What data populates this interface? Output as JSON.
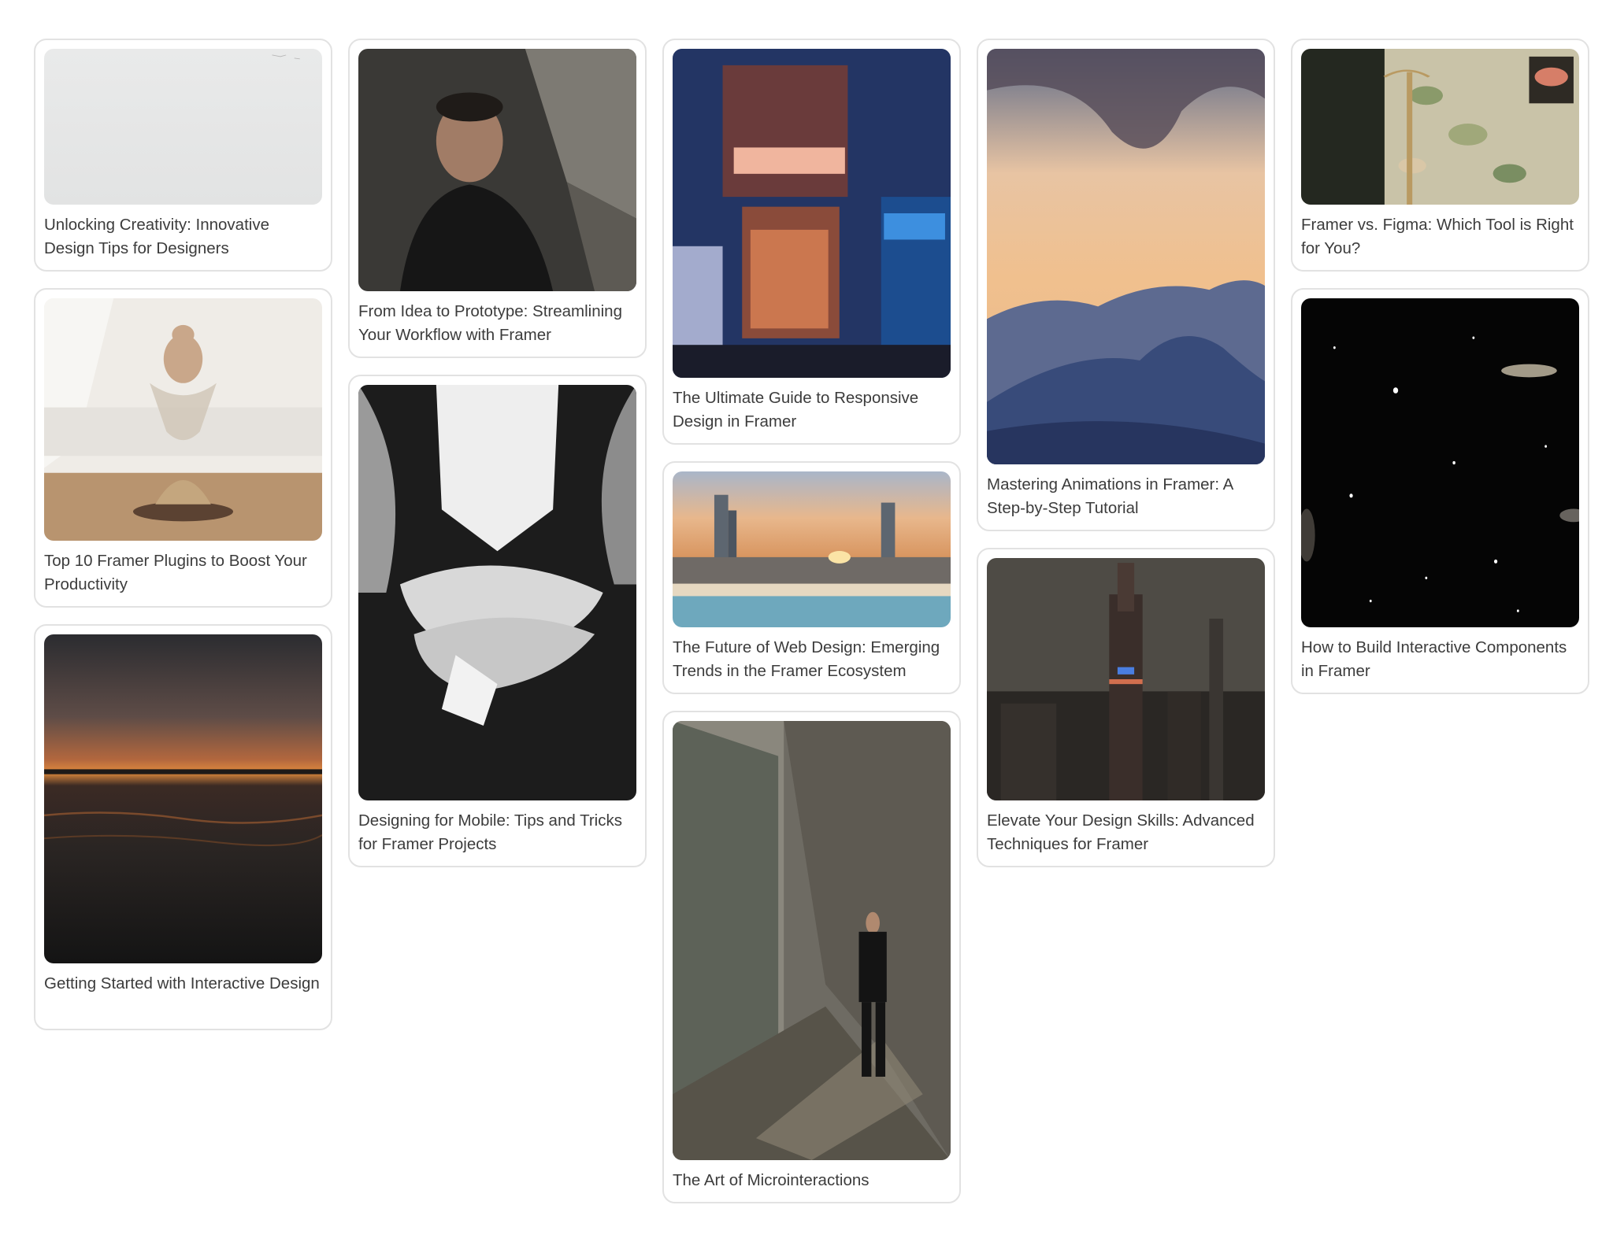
{
  "columns": [
    [
      {
        "title": "Unlocking Creativity: Innovative Design Tips for Designers",
        "image": "grey-sky-photo"
      },
      {
        "title": "Top 10 Framer Plugins to Boost Your Productivity",
        "image": "hourglass-sculpture-photo"
      },
      {
        "title": "Getting Started with Interactive Design",
        "image": "sunset-over-sea-photo"
      }
    ],
    [
      {
        "title": "From Idea to Prototype: Streamlining Your Workflow with Framer",
        "image": "man-portrait-photo"
      },
      {
        "title": "Designing for Mobile: Tips and Tricks for Framer Projects",
        "image": "holding-hands-bw-photo"
      }
    ],
    [
      {
        "title": "The Ultimate Guide to Responsive Design in Framer",
        "image": "neon-street-shop-photo"
      },
      {
        "title": "The Future of Web Design: Emerging Trends in the Framer Ecosystem",
        "image": "coastal-city-sunset-photo"
      },
      {
        "title": "The Art of Microinteractions",
        "image": "man-in-corridor-photo"
      }
    ],
    [
      {
        "title": "Mastering Animations in Framer: A Step-by-Step Tutorial",
        "image": "mountain-sunset-photo"
      },
      {
        "title": "Elevate Your Design Skills: Advanced Techniques for Framer",
        "image": "city-skyline-night-photo"
      }
    ],
    [
      {
        "title": "Framer vs. Figma: Which Tool is Right for You?",
        "image": "floral-wallpaper-coat-rack-photo"
      },
      {
        "title": "How to Build Interactive Components in Framer",
        "image": "starry-space-galaxies-photo"
      }
    ]
  ]
}
